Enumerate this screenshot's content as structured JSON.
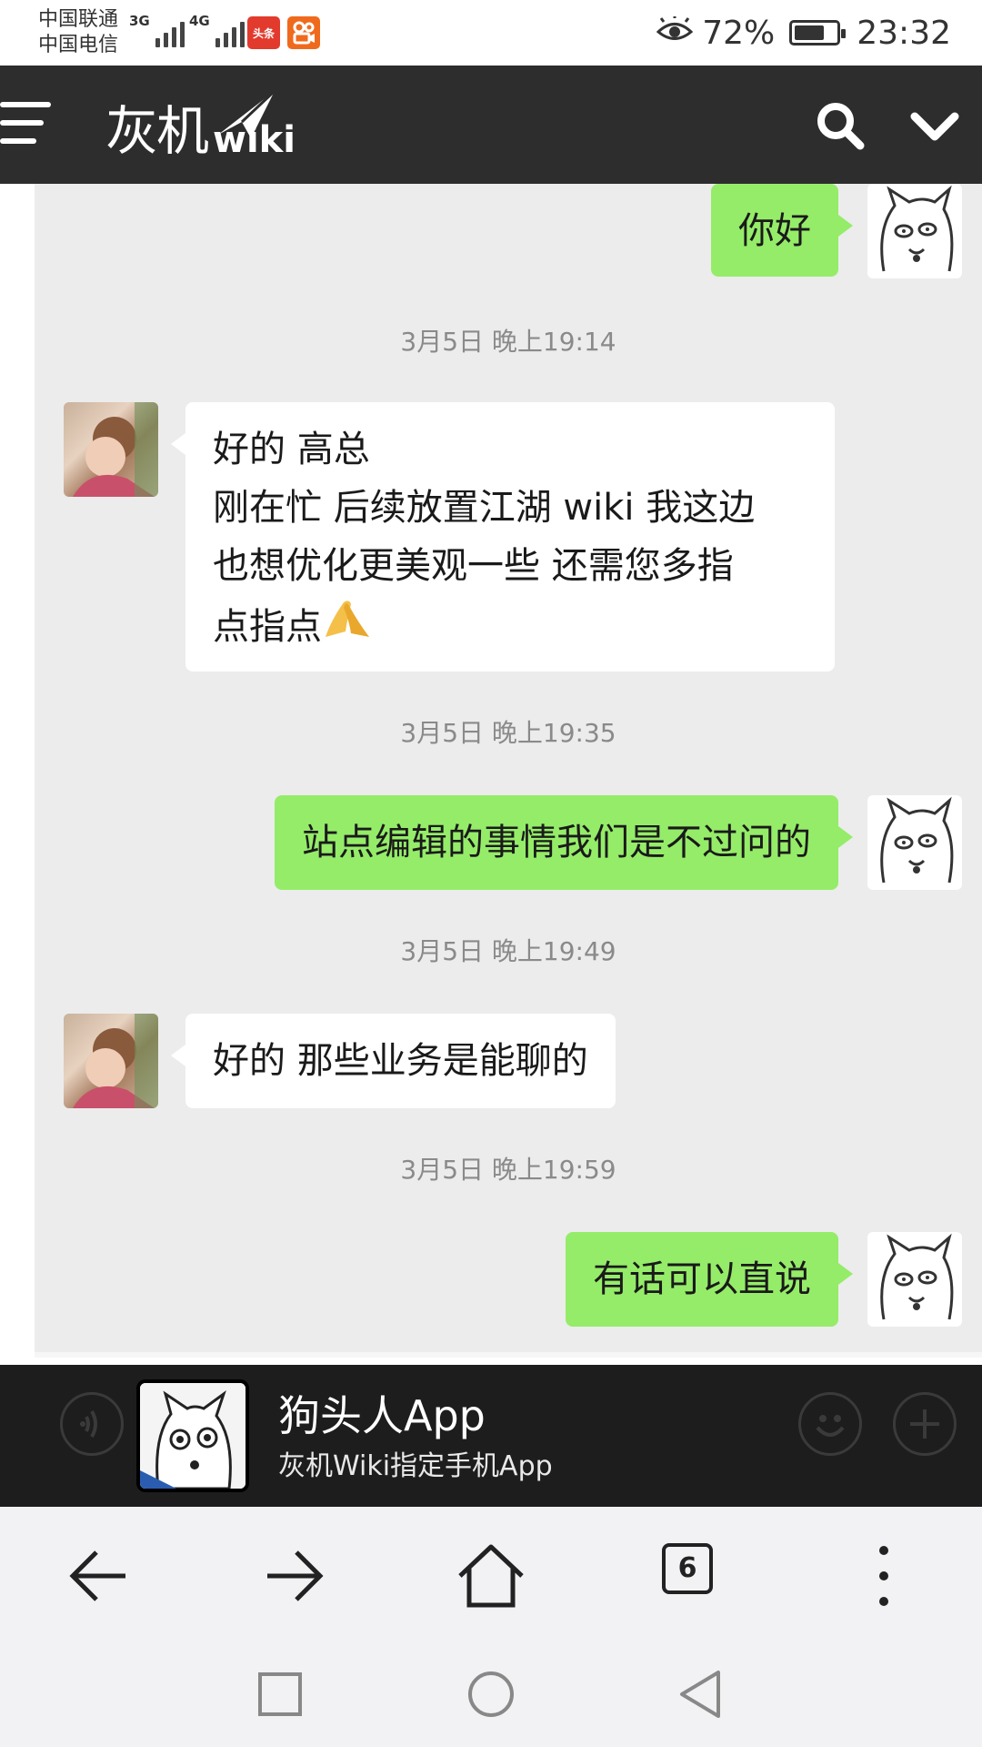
{
  "status_bar": {
    "carrier_1": "中国联通",
    "carrier_2": "中国电信",
    "net_1": "3G",
    "net_2": "4G",
    "app_icon_1": "头条",
    "battery_percent": "72%",
    "battery_level": 0.72,
    "time": "23:32"
  },
  "header": {
    "brand_cn": "灰机",
    "brand_en": "wiki",
    "icons": [
      "menu-icon",
      "search-icon",
      "chevron-down-icon"
    ]
  },
  "chat": {
    "messages": [
      {
        "side": "out",
        "text": "你好"
      },
      {
        "timestamp": "3月5日 晚上19:14"
      },
      {
        "side": "in",
        "lines": [
          "好的 高总",
          "刚在忙 后续放置江湖 wiki 我这边",
          "也想优化更美观一些 还需您多指",
          "点指点"
        ],
        "emoji": "pray-emoji"
      },
      {
        "timestamp": "3月5日 晚上19:35"
      },
      {
        "side": "out",
        "text": "站点编辑的事情我们是不过问的"
      },
      {
        "timestamp": "3月5日 晚上19:49"
      },
      {
        "side": "in",
        "text": "好的 那些业务是能聊的"
      },
      {
        "timestamp": "3月5日 晚上19:59"
      },
      {
        "side": "out",
        "text": "有话可以直说"
      }
    ]
  },
  "promo": {
    "title": "狗头人App",
    "subtitle": "灰机Wiki指定手机App",
    "icons": [
      "voice-icon",
      "emoji-icon",
      "plus-icon"
    ]
  },
  "browser_toolbar": {
    "tab_count": "6",
    "icons": [
      "back-arrow-icon",
      "forward-arrow-icon",
      "home-icon",
      "tabs-icon",
      "more-icon"
    ]
  },
  "system_nav": {
    "icons": [
      "recents-icon",
      "home-circle-icon",
      "back-triangle-icon"
    ]
  }
}
